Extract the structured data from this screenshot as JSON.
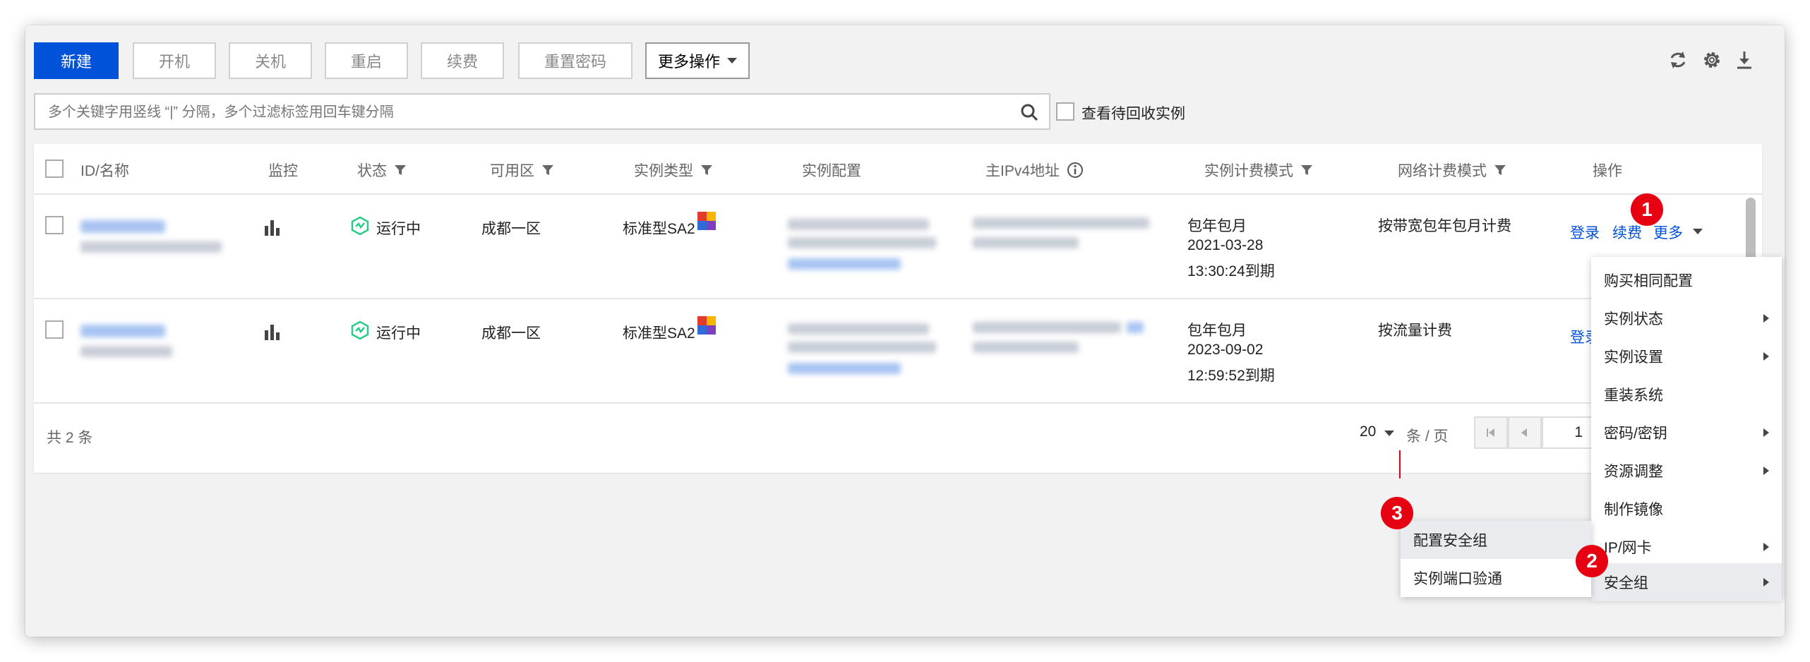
{
  "toolbar": {
    "new_label": "新建",
    "start_label": "开机",
    "shutdown_label": "关机",
    "restart_label": "重启",
    "renew_label": "续费",
    "reset_password_label": "重置密码",
    "more_actions_label": "更多操作"
  },
  "top_icons": [
    "refresh-icon",
    "gear-icon",
    "download-icon"
  ],
  "search": {
    "placeholder": "多个关键字用竖线 “|” 分隔，多个过滤标签用回车键分隔",
    "value": ""
  },
  "recycle_checkbox_label": "查看待回收实例",
  "table": {
    "headers": {
      "id_name": "ID/名称",
      "monitor": "监控",
      "status": "状态",
      "zone": "可用区",
      "instance_type": "实例类型",
      "instance_config": "实例配置",
      "ipv4": "主IPv4地址",
      "billing_mode": "实例计费模式",
      "network_billing": "网络计费模式",
      "actions": "操作"
    },
    "rows": [
      {
        "status": "运行中",
        "zone": "成都一区",
        "instance_type": "标准型SA2",
        "billing_line1": "包年包月",
        "billing_line2": "2021-03-28",
        "billing_line3": "13:30:24到期",
        "network_billing": "按带宽包年包月计费",
        "action_login": "登录",
        "action_renew": "续费",
        "action_more": "更多"
      },
      {
        "status": "运行中",
        "zone": "成都一区",
        "instance_type": "标准型SA2",
        "billing_line1": "包年包月",
        "billing_line2": "2023-09-02",
        "billing_line3": "12:59:52到期",
        "network_billing": "按流量计费",
        "action_login": "登录"
      }
    ]
  },
  "footer": {
    "total": "共 2 条",
    "page_size": "20",
    "page_size_unit": "条 / 页",
    "page_number": "1"
  },
  "more_menu": {
    "items": [
      {
        "label": "购买相同配置",
        "submenu": false
      },
      {
        "label": "实例状态",
        "submenu": true
      },
      {
        "label": "实例设置",
        "submenu": true
      },
      {
        "label": "重装系统",
        "submenu": false
      },
      {
        "label": "密码/密钥",
        "submenu": true
      },
      {
        "label": "资源调整",
        "submenu": true
      },
      {
        "label": "制作镜像",
        "submenu": false
      },
      {
        "label": "IP/网卡",
        "submenu": true
      },
      {
        "label": "安全组",
        "submenu": true
      }
    ]
  },
  "security_submenu": {
    "items": [
      {
        "label": "配置安全组"
      },
      {
        "label": "实例端口验通"
      }
    ]
  },
  "step_badges": [
    "1",
    "2",
    "3"
  ],
  "colors": {
    "primary": "#0052d9",
    "badge": "#e60012",
    "running": "#29cc85"
  }
}
